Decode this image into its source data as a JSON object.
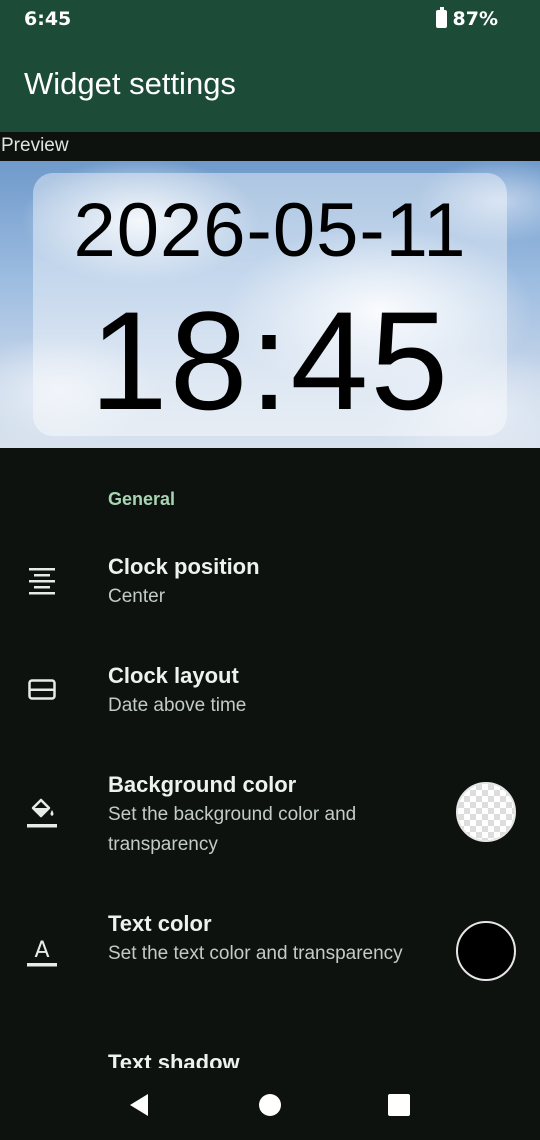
{
  "status_bar": {
    "time": "6:45",
    "battery": "87%"
  },
  "app_bar": {
    "title": "Widget settings"
  },
  "preview": {
    "label": "Preview",
    "date": "2026-05-11",
    "time": "18:45"
  },
  "section": {
    "title": "General"
  },
  "settings": [
    {
      "title": "Clock position",
      "summary": "Center",
      "icon": "align-center-icon"
    },
    {
      "title": "Clock layout",
      "summary": "Date above time",
      "icon": "layout-icon"
    },
    {
      "title": "Background color",
      "summary": "Set the background color and transparency",
      "icon": "fill-color-icon",
      "swatch": "transparent"
    },
    {
      "title": "Text color",
      "summary": "Set the text color and transparency",
      "icon": "text-color-icon",
      "swatch": "#000000"
    },
    {
      "title": "Text shadow",
      "icon": "text-shadow-icon"
    }
  ],
  "colors": {
    "app_bar": "#1c4c38",
    "background": "#0d120f",
    "accent": "#a9d4b4"
  }
}
